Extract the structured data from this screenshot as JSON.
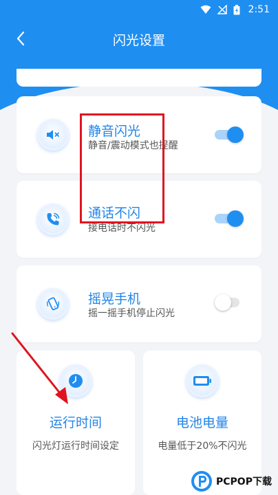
{
  "status_bar": {
    "time": "2:51"
  },
  "header": {
    "title": "闪光设置"
  },
  "settings": [
    {
      "title": "静音闪光",
      "subtitle": "静音/震动模式也提醒",
      "toggle": "on",
      "icon": "mute-speaker-icon"
    },
    {
      "title": "通话不闪",
      "subtitle": "接电话时不闪光",
      "toggle": "on",
      "icon": "phone-call-icon"
    },
    {
      "title": "摇晃手机",
      "subtitle": "摇一摇手机停止闪光",
      "toggle": "off",
      "icon": "shake-phone-icon"
    }
  ],
  "tiles": [
    {
      "title": "运行时间",
      "subtitle": "闪光灯运行时间设定",
      "icon": "clock-icon"
    },
    {
      "title": "电池电量",
      "subtitle": "电量低于20%不闪光",
      "icon": "battery-icon"
    }
  ],
  "colors": {
    "primary": "#1f8ef1",
    "annotation": "#e0131f"
  },
  "watermark": {
    "brand": "PCPOP下载"
  }
}
